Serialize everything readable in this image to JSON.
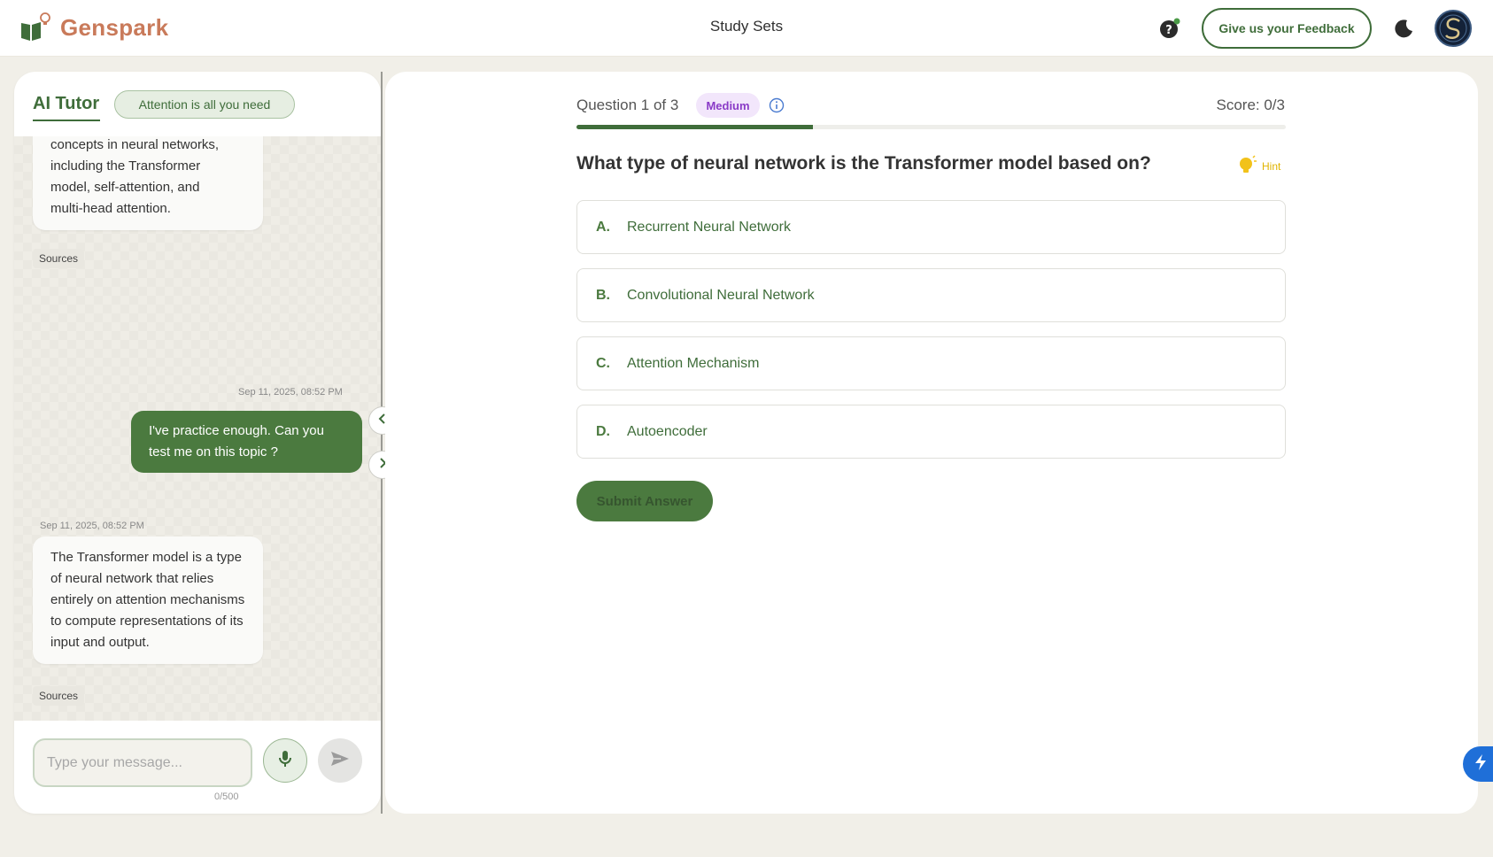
{
  "header": {
    "brand": "Genspark",
    "center_title": "Study Sets",
    "feedback_label": "Give us your Feedback"
  },
  "tutor": {
    "tab_label": "AI Tutor",
    "topic": "Attention is all you need",
    "messages": [
      {
        "role": "assistant",
        "text_lines": [
          "concepts in neural networks,",
          "including the Transformer",
          "model, self-attention, and",
          "multi-head attention."
        ],
        "sources_label": "Sources"
      },
      {
        "role": "user",
        "timestamp": "Sep 11, 2025, 08:52 PM",
        "text": "I've practice enough. Can you test me on this topic ?"
      },
      {
        "role": "assistant",
        "timestamp": "Sep 11, 2025, 08:52 PM",
        "text": "The Transformer model is a type of neural network that relies entirely on attention mechanisms to compute representations of its input and output.",
        "sources_label": "Sources"
      }
    ],
    "input": {
      "placeholder": "Type your message...",
      "value": "",
      "char_count": "0/500"
    }
  },
  "quiz": {
    "progress_label": "Question 1 of 3",
    "progress_fraction": 0.333,
    "difficulty": "Medium",
    "score": "Score: 0/3",
    "question": "What type of neural network is the Transformer model based on?",
    "hint_label": "Hint",
    "options": [
      {
        "letter": "A.",
        "text": "Recurrent Neural Network"
      },
      {
        "letter": "B.",
        "text": "Convolutional Neural Network"
      },
      {
        "letter": "C.",
        "text": "Attention Mechanism"
      },
      {
        "letter": "D.",
        "text": "Autoencoder"
      }
    ],
    "submit_label": "Submit Answer"
  },
  "icons": {
    "brand": "book-lightbulb-icon",
    "help": "question-circle-icon",
    "theme": "moon-icon",
    "mic": "microphone-icon",
    "send": "send-icon",
    "collapse_left": "chevron-left-icon",
    "expand_right": "chevron-right-icon",
    "info": "info-icon",
    "hint": "lightbulb-icon",
    "quick": "lightning-icon"
  },
  "colors": {
    "brand": "#c97a5a",
    "accent": "#3f6d3a",
    "user_bubble": "#4b7a3f",
    "difficulty_bg": "#f2e6fb",
    "difficulty_text": "#8a3bc7",
    "hint": "#e0b400",
    "quick_action": "#1f6fd8"
  }
}
